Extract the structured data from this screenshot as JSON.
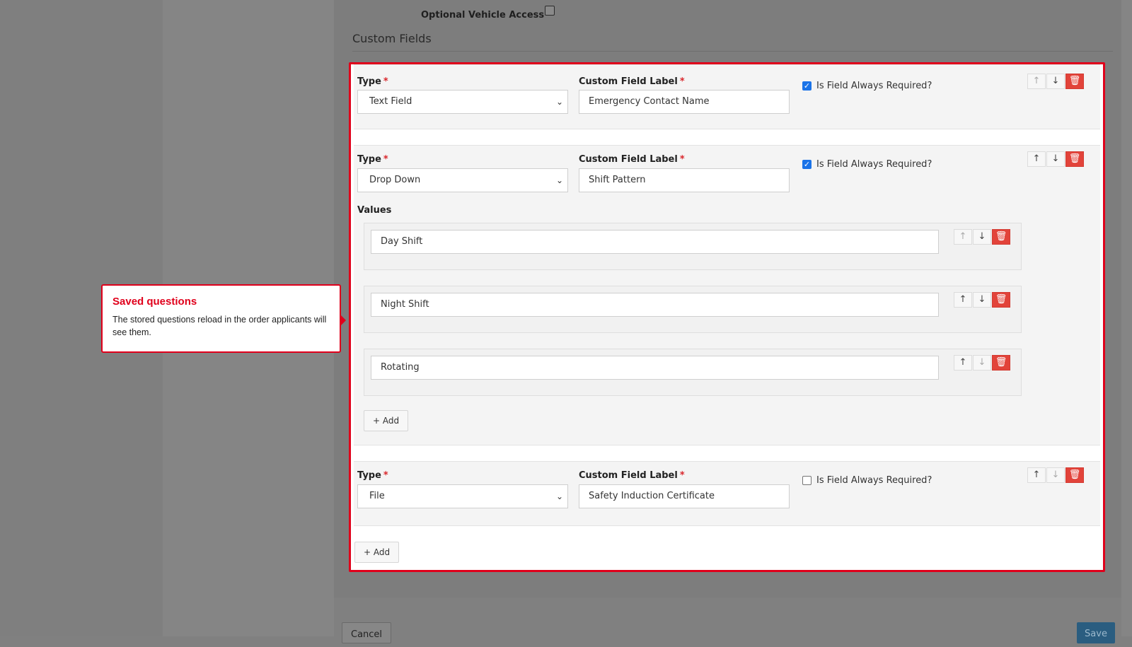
{
  "form": {
    "vehicle_access_label": "Optional Vehicle Access",
    "vehicle_access_checked": false,
    "custom_fields_heading": "Custom Fields",
    "type_label": "Type",
    "custom_label_label": "Custom Field Label",
    "required_mark": "*",
    "required_toggle_label": "Is Field Always Required?",
    "values_label": "Values",
    "add_label": "Add",
    "fields": [
      {
        "type": "Text Field",
        "label": "Emergency Contact Name",
        "always_required": true
      },
      {
        "type": "Drop Down",
        "label": "Shift Pattern",
        "always_required": true,
        "values": [
          "Day Shift",
          "Night Shift",
          "Rotating"
        ]
      },
      {
        "type": "File",
        "label": "Safety Induction Certificate",
        "always_required": false
      }
    ]
  },
  "callout": {
    "title": "Saved questions",
    "body": "The stored questions reload in the order applicants will see them."
  },
  "footer": {
    "cancel_label": "Cancel",
    "save_label": "Save"
  },
  "colors": {
    "highlight": "#e0001b",
    "delete": "#e2433a",
    "checkbox": "#1a73e8",
    "save": "#2a5d80"
  },
  "icons": {
    "up": "arrow-up-icon",
    "down": "arrow-down-icon",
    "delete": "trash-icon",
    "add": "plus-icon",
    "select": "chevron-down-icon"
  }
}
